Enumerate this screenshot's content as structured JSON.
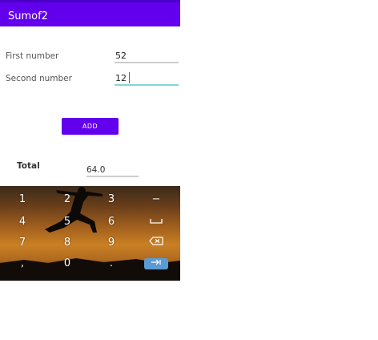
{
  "app": {
    "title": "Sumof2",
    "accent_color": "#6200ee"
  },
  "form": {
    "first_label": "First number",
    "first_value": "52",
    "second_label": "Second number",
    "second_value": "12",
    "add_label": "ADD",
    "total_label": "Total",
    "total_value": "64.0"
  },
  "keyboard": {
    "keys": [
      [
        "1",
        "2",
        "3",
        "−"
      ],
      [
        "4",
        "5",
        "6",
        "space-icon"
      ],
      [
        "7",
        "8",
        "9",
        "backspace-icon"
      ],
      [
        ",",
        "0",
        ".",
        "next-icon"
      ]
    ]
  }
}
